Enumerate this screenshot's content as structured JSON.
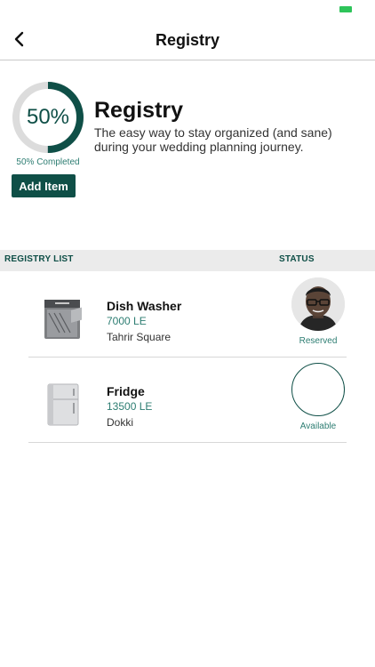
{
  "nav": {
    "title": "Registry"
  },
  "summary": {
    "percent_label": "50%",
    "progress": 0.5,
    "completed_label": "50% Completed",
    "add_button": "Add Item",
    "title": "Registry",
    "subtitle": "The easy way to stay organized (and sane) during your wedding planning journey."
  },
  "list": {
    "header_left": "REGISTRY LIST",
    "header_right": "STATUS",
    "items": [
      {
        "name": "Dish Washer",
        "price": "7000 LE",
        "location": "Tahrir Square",
        "status": "Reserved",
        "icon": "dishwasher-icon"
      },
      {
        "name": "Fridge",
        "price": "13500 LE",
        "location": "Dokki",
        "status": "Available",
        "icon": "fridge-icon"
      }
    ]
  },
  "colors": {
    "accent": "#0f4f47",
    "accent_light": "#2d7d72",
    "ring_track": "#dcdcdc",
    "battery": "#2ec45a"
  }
}
